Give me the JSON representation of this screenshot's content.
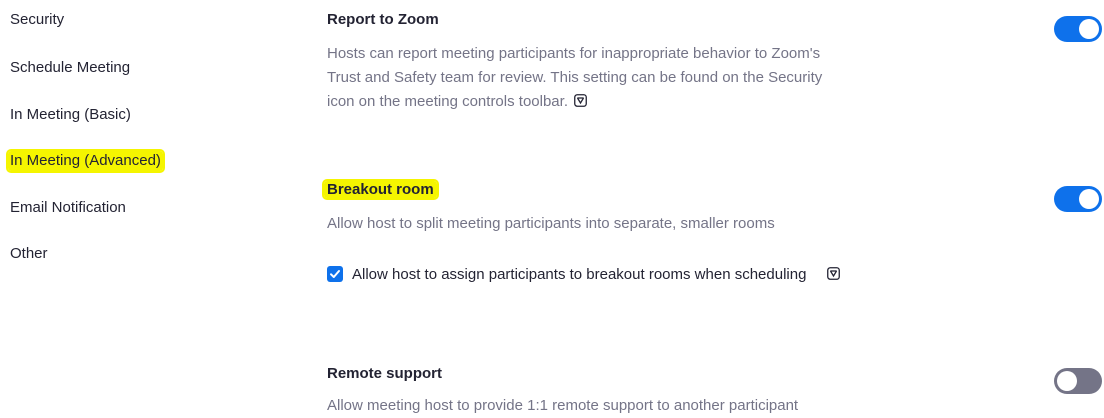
{
  "sidebar": {
    "items": [
      {
        "label": "Security"
      },
      {
        "label": "Schedule Meeting"
      },
      {
        "label": "In Meeting (Basic)"
      },
      {
        "label": "In Meeting (Advanced)",
        "active": true
      },
      {
        "label": "Email Notification"
      },
      {
        "label": "Other"
      }
    ]
  },
  "settings": {
    "report_to_zoom": {
      "title": "Report to Zoom",
      "description": "Hosts can report meeting participants for inappropriate behavior to Zoom's Trust and Safety team for review. This setting can be found on the Security icon on the meeting controls toolbar.",
      "enabled": true
    },
    "breakout_room": {
      "title": "Breakout room",
      "description": "Allow host to split meeting participants into separate, smaller rooms",
      "enabled": true,
      "option": {
        "label": "Allow host to assign participants to breakout rooms when scheduling",
        "checked": true
      }
    },
    "remote_support": {
      "title": "Remote support",
      "description": "Allow meeting host to provide 1:1 remote support to another participant",
      "enabled": false
    }
  },
  "colors": {
    "accent": "#0e71eb",
    "highlight": "#f5f500",
    "toggle_off": "#747487",
    "text": "#232333",
    "muted_text": "#747487"
  }
}
